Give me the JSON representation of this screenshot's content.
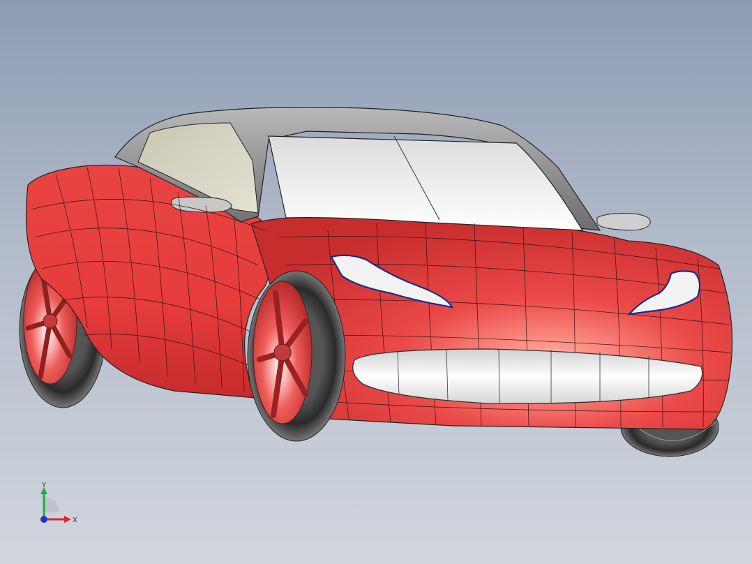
{
  "viewport": {
    "background_top": "#8d9bb3",
    "background_bottom": "#d1d6de"
  },
  "model": {
    "body_color": "#e3403f",
    "body_highlight": "#ff8a80",
    "glass_color": "#f2f2f2",
    "cabin_color": "#7a7a7a",
    "tire_color": "#333333"
  },
  "triad": {
    "x_label": "X",
    "y_label": "Y",
    "x_color": "#e0242a",
    "y_color": "#1fae3a",
    "z_color": "#2036c8"
  }
}
